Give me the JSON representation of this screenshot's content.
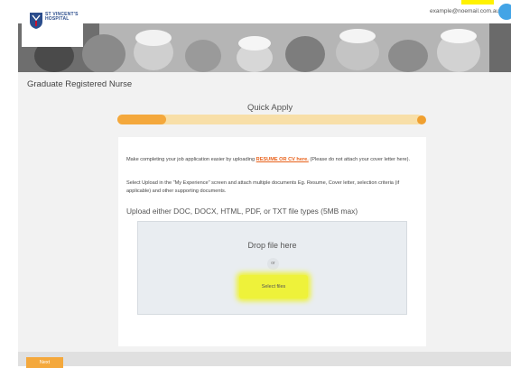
{
  "header": {
    "logo_text": "ST VINCENT'S HOSPITAL",
    "user_email": "example@noemail.com.au"
  },
  "job": {
    "title": "Graduate Registered Nurse"
  },
  "form": {
    "step_title": "Quick Apply",
    "progress_fraction": 0.16,
    "intro_prefix": "Make completing your job application easier by uploading ",
    "intro_link": "RESUME OR CV here.",
    "intro_suffix": " (Please do not attach your cover letter here).",
    "instructions": "Select Upload in the \"My Experience\" screen and attach multiple documents Eg. Resume, Cover letter, selection criteria (if applicable) and other supporting documents.",
    "upload_heading": "Upload either DOC, DOCX, HTML, PDF, or TXT file types (5MB max)",
    "dropzone": {
      "drop_label": "Drop file here",
      "or_label": "or",
      "select_button": "Select files"
    }
  },
  "footer": {
    "next_label": "Next"
  },
  "colors": {
    "accent": "#f4a83c",
    "link": "#e8611a",
    "highlight": "#eef23a"
  },
  "icons": [
    "hospital-logo-icon",
    "user-avatar-icon"
  ]
}
